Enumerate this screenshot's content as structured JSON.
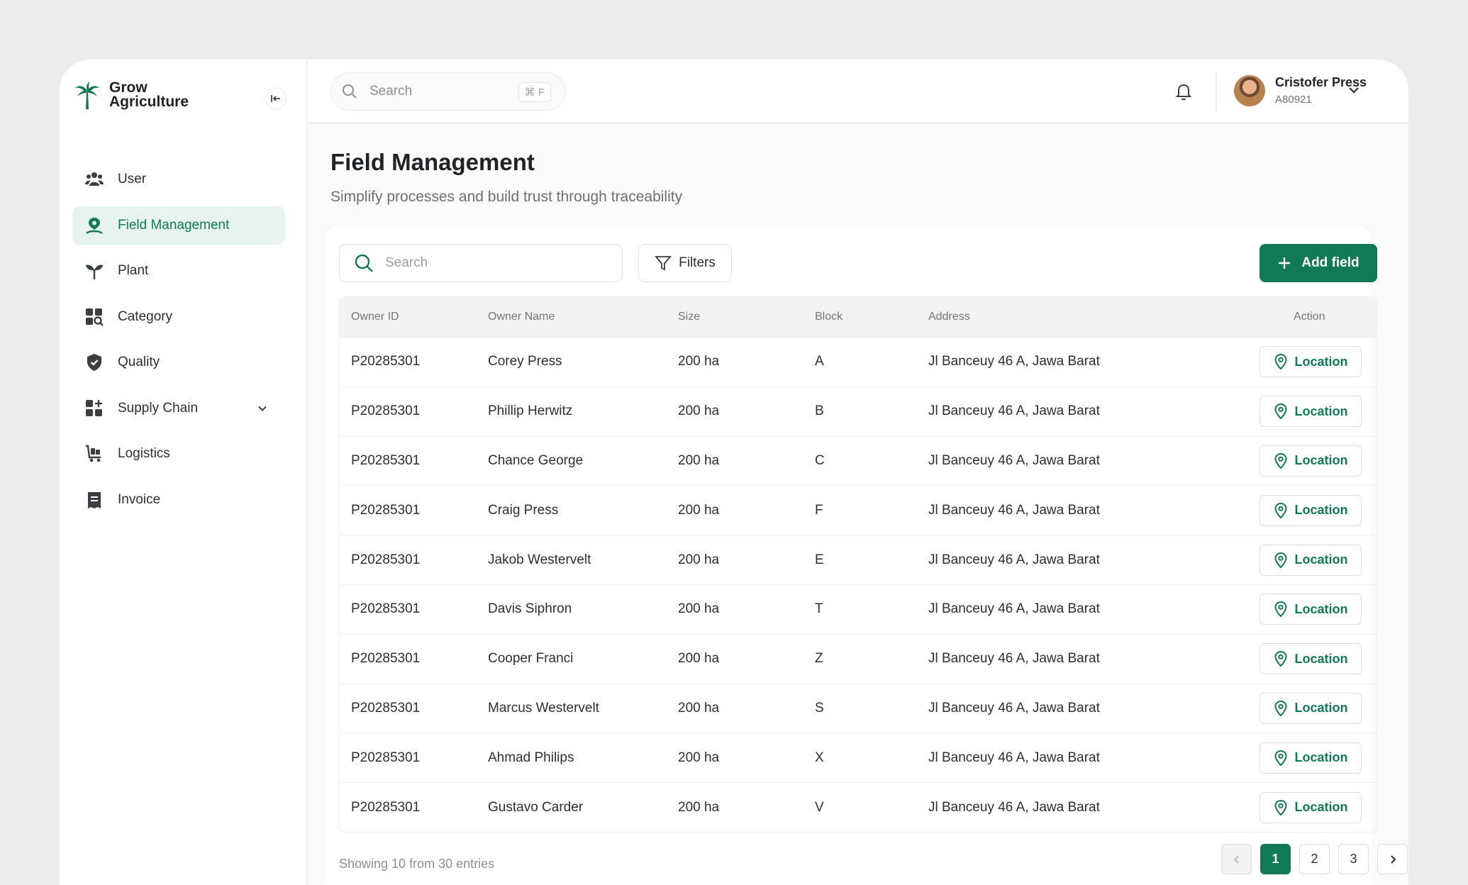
{
  "brand": {
    "line1": "Grow",
    "line2": "Agriculture"
  },
  "sidebar": {
    "items": [
      {
        "label": "User",
        "icon": "users-icon"
      },
      {
        "label": "Field Management",
        "icon": "field-location-icon",
        "active": true
      },
      {
        "label": "Plant",
        "icon": "sprout-icon"
      },
      {
        "label": "Category",
        "icon": "category-grid-icon"
      },
      {
        "label": "Quality",
        "icon": "shield-check-icon"
      },
      {
        "label": "Supply Chain",
        "icon": "supply-chain-icon",
        "expandable": true
      },
      {
        "label": "Logistics",
        "icon": "cart-icon"
      },
      {
        "label": "Invoice",
        "icon": "invoice-icon"
      }
    ]
  },
  "topbar": {
    "search_placeholder": "Search",
    "shortcut": "⌘ F",
    "user_name": "Cristofer Press",
    "user_id": "A80921"
  },
  "page": {
    "title": "Field Management",
    "subtitle": "Simplify processes and build trust through traceability"
  },
  "toolbar": {
    "search_placeholder": "Search",
    "filters_label": "Filters",
    "add_label": "Add field"
  },
  "table": {
    "headers": [
      "Owner ID",
      "Owner Name",
      "Size",
      "Block",
      "Address",
      "Action"
    ],
    "action_label": "Location",
    "rows": [
      [
        "P20285301",
        "Corey Press",
        "200 ha",
        "A",
        "Jl Banceuy 46 A, Jawa Barat"
      ],
      [
        "P20285301",
        "Phillip Herwitz",
        "200 ha",
        "B",
        "Jl Banceuy 46 A, Jawa Barat"
      ],
      [
        "P20285301",
        "Chance George",
        "200 ha",
        "C",
        "Jl Banceuy 46 A, Jawa Barat"
      ],
      [
        "P20285301",
        "Craig Press",
        "200 ha",
        "F",
        "Jl Banceuy 46 A, Jawa Barat"
      ],
      [
        "P20285301",
        "Jakob Westervelt",
        "200 ha",
        "E",
        "Jl Banceuy 46 A, Jawa Barat"
      ],
      [
        "P20285301",
        "Davis Siphron",
        "200 ha",
        "T",
        "Jl Banceuy 46 A, Jawa Barat"
      ],
      [
        "P20285301",
        "Cooper Franci",
        "200 ha",
        "Z",
        "Jl Banceuy 46 A, Jawa Barat"
      ],
      [
        "P20285301",
        "Marcus Westervelt",
        "200 ha",
        "S",
        "Jl Banceuy 46 A, Jawa Barat"
      ],
      [
        "P20285301",
        "Ahmad Philips",
        "200 ha",
        "X",
        "Jl Banceuy 46 A, Jawa Barat"
      ],
      [
        "P20285301",
        "Gustavo Carder",
        "200 ha",
        "V",
        "Jl Banceuy 46 A, Jawa Barat"
      ]
    ]
  },
  "pagination": {
    "summary": "Showing 10 from 30 entries",
    "pages": [
      "1",
      "2",
      "3"
    ],
    "current": "1"
  },
  "colors": {
    "accent": "#0f7a55",
    "accent_light": "#e6f3ee"
  }
}
